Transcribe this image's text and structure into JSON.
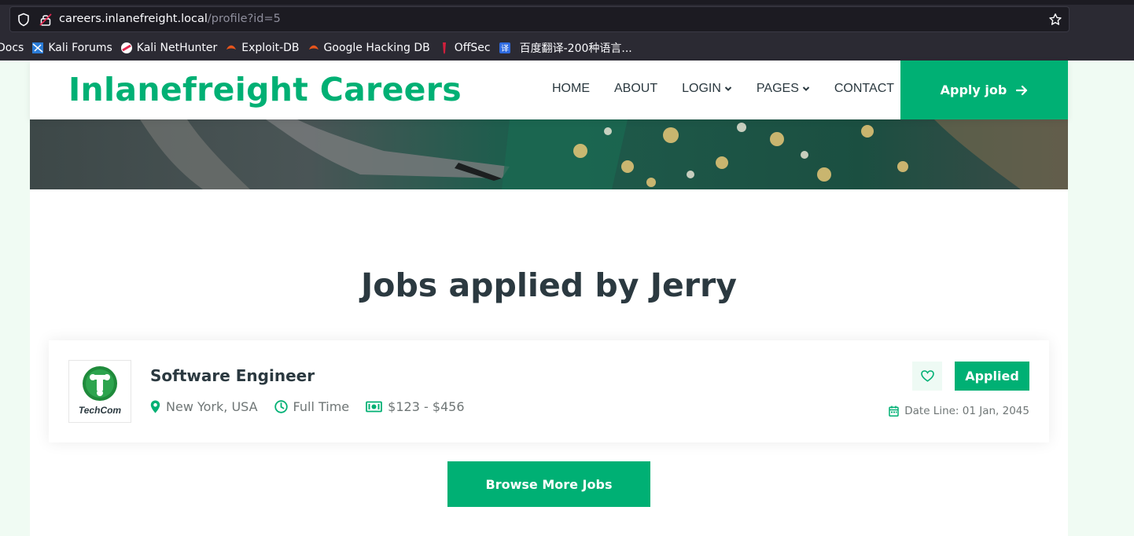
{
  "browser": {
    "url_host": "careers.inlanefreight.local",
    "url_path": "/profile?id=5",
    "bookmarks": [
      "Docs",
      "Kali Forums",
      "Kali NetHunter",
      "Exploit-DB",
      "Google Hacking DB",
      "OffSec",
      "百度翻译-200种语言..."
    ]
  },
  "navbar": {
    "brand": "Inlanefreight Careers",
    "items": [
      "HOME",
      "ABOUT",
      "LOGIN",
      "PAGES",
      "CONTACT"
    ],
    "apply_label": "Apply job"
  },
  "main": {
    "title": "Jobs applied by Jerry",
    "job": {
      "company_logo_text": "TechCom",
      "title": "Software Engineer",
      "location": "New York, USA",
      "type": "Full Time",
      "salary": "$123 - $456",
      "status": "Applied",
      "date_line": "Date Line: 01 Jan, 2045"
    },
    "browse_label": "Browse More Jobs"
  },
  "colors": {
    "accent": "#00b074",
    "text": "#2b3940"
  }
}
